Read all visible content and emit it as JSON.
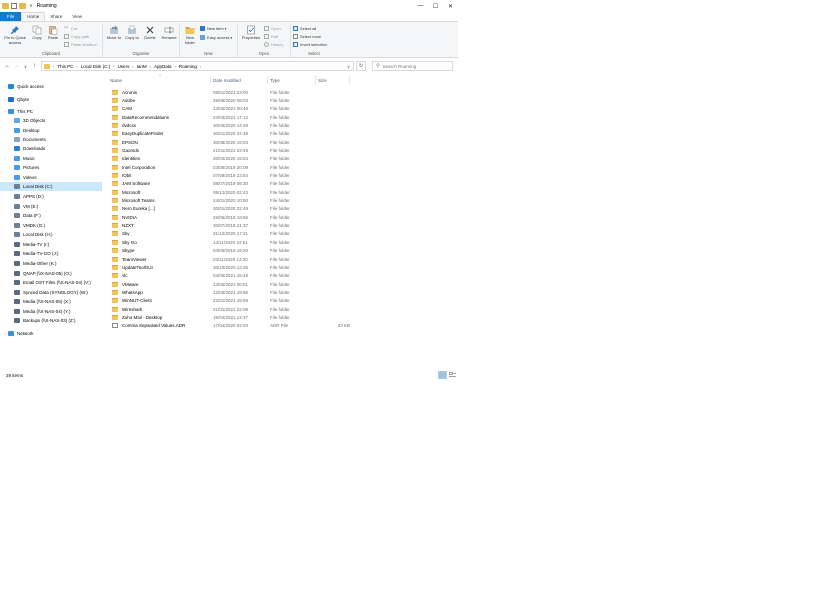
{
  "window": {
    "title": "Roaming",
    "minimize": "—",
    "maximize": "☐",
    "close": "✕"
  },
  "tabs": [
    {
      "label": "File"
    },
    {
      "label": "Home"
    },
    {
      "label": "Share"
    },
    {
      "label": "View"
    }
  ],
  "ribbon": {
    "clipboard": {
      "label": "Clipboard",
      "pin": "Pin to Quick access",
      "copy": "Copy",
      "paste": "Paste",
      "cut": "Cut",
      "copy_path": "Copy path",
      "paste_shortcut": "Paste shortcut"
    },
    "organise": {
      "label": "Organise",
      "move_to": "Move to",
      "copy_to": "Copy to",
      "delete": "Delete",
      "rename": "Rename"
    },
    "new": {
      "label": "New",
      "new_folder": "New folder",
      "new_item": "New item",
      "easy_access": "Easy access"
    },
    "open": {
      "label": "Open",
      "properties": "Properties",
      "open": "Open",
      "edit": "Edit",
      "history": "History"
    },
    "select": {
      "label": "Select",
      "select_all": "Select all",
      "select_none": "Select none",
      "invert": "Invert selection"
    }
  },
  "address": {
    "crumbs": [
      "This PC",
      "Local Disk (C:)",
      "Users",
      "IanM",
      "AppData",
      "Roaming"
    ],
    "search_placeholder": "Search Roaming"
  },
  "nav": [
    {
      "label": "Quick access",
      "icon": "star-icon",
      "color": "#1e88e5",
      "level": 0
    },
    {
      "label": "Qbyte",
      "icon": "cloud-icon",
      "color": "#1e6fbf",
      "level": 0
    },
    {
      "label": "This PC",
      "icon": "computer-icon",
      "color": "#3a8ee6",
      "level": 0
    },
    {
      "label": "3D Objects",
      "icon": "cube-icon",
      "color": "#5fa8e8",
      "level": 1
    },
    {
      "label": "Desktop",
      "icon": "desktop-icon",
      "color": "#4a9be6",
      "level": 1
    },
    {
      "label": "Documents",
      "icon": "documents-icon",
      "color": "#8aa4c0",
      "level": 1
    },
    {
      "label": "Downloads",
      "icon": "download-icon",
      "color": "#2a7fd6",
      "level": 1
    },
    {
      "label": "Music",
      "icon": "music-icon",
      "color": "#4a9be6",
      "level": 1
    },
    {
      "label": "Pictures",
      "icon": "pictures-icon",
      "color": "#4a9be6",
      "level": 1
    },
    {
      "label": "Videos",
      "icon": "videos-icon",
      "color": "#4a9be6",
      "level": 1
    },
    {
      "label": "Local Disk (C:)",
      "icon": "drive-icon",
      "color": "#6d7f93",
      "level": 1,
      "selected": true
    },
    {
      "label": "APPS (D:)",
      "icon": "drive-icon",
      "color": "#6d7f93",
      "level": 1
    },
    {
      "label": "VM (E:)",
      "icon": "drive-icon",
      "color": "#6d7f93",
      "level": 1
    },
    {
      "label": "Data (F:)",
      "icon": "drive-icon",
      "color": "#6d7f93",
      "level": 1
    },
    {
      "label": "VMDK (G:)",
      "icon": "drive-icon",
      "color": "#6d7f93",
      "level": 1
    },
    {
      "label": "Local Disk (H:)",
      "icon": "drive-icon",
      "color": "#6d7f93",
      "level": 1
    },
    {
      "label": "Media-TV (I:)",
      "icon": "network-drive-icon",
      "color": "#5b6b7c",
      "level": 1
    },
    {
      "label": "Media-TV-GO (J:)",
      "icon": "network-drive-icon",
      "color": "#5b6b7c",
      "level": 1
    },
    {
      "label": "Media-Other (K:)",
      "icon": "network-drive-icon",
      "color": "#5b6b7c",
      "level": 1
    },
    {
      "label": "QNAP (\\\\X-NAS-05) (O:)",
      "icon": "network-drive-icon",
      "color": "#5b6b7c",
      "level": 1
    },
    {
      "label": "Email OST Files (\\\\X-NAS-04) (V:)",
      "icon": "network-drive-icon",
      "color": "#5b6b7c",
      "level": 1
    },
    {
      "label": "Synced Data (SYNOLOGY) (W:)",
      "icon": "network-drive-icon",
      "color": "#5b6b7c",
      "level": 1
    },
    {
      "label": "Media (\\\\X-NAS-05) (X:)",
      "icon": "network-drive-icon",
      "color": "#5b6b7c",
      "level": 1
    },
    {
      "label": "Media (\\\\X-NAS-04) (Y:)",
      "icon": "network-drive-icon",
      "color": "#5b6b7c",
      "level": 1
    },
    {
      "label": "Backups (\\\\X-NAS-03) (Z:)",
      "icon": "network-drive-icon",
      "color": "#5b6b7c",
      "level": 1
    },
    {
      "label": "Network",
      "icon": "network-icon",
      "color": "#3a8ee6",
      "level": 0
    }
  ],
  "columns": {
    "name": "Name",
    "date": "Date modified",
    "type": "Type",
    "size": "Size"
  },
  "files": [
    {
      "name": "Acronis",
      "date": "09/01/2021 23:00",
      "type": "File folder",
      "size": ""
    },
    {
      "name": "Adobe",
      "date": "26/06/2020 08:03",
      "type": "File folder",
      "size": ""
    },
    {
      "name": "CAM",
      "date": "13/05/2021 00:48",
      "type": "File folder",
      "size": ""
    },
    {
      "name": "DataRecommendations",
      "date": "24/03/2021 17:12",
      "type": "File folder",
      "size": ""
    },
    {
      "name": "dvdcss",
      "date": "30/05/2020 14:29",
      "type": "File folder",
      "size": ""
    },
    {
      "name": "EasyDuplicateFinder",
      "date": "30/01/2020 22:49",
      "type": "File folder",
      "size": ""
    },
    {
      "name": "EPSON",
      "date": "30/08/2020 15:03",
      "type": "File folder",
      "size": ""
    },
    {
      "name": "Gaomds",
      "date": "21/01/2021 23:49",
      "type": "File folder",
      "size": ""
    },
    {
      "name": "Identities",
      "date": "20/04/2020 15:04",
      "type": "File folder",
      "size": ""
    },
    {
      "name": "Intel Corporation",
      "date": "03/05/2019 20:09",
      "type": "File folder",
      "size": ""
    },
    {
      "name": "IObit",
      "date": "07/08/2019 22:54",
      "type": "File folder",
      "size": ""
    },
    {
      "name": "JAM Software",
      "date": "08/07/2019 08:30",
      "type": "File folder",
      "size": ""
    },
    {
      "name": "Microsoft",
      "date": "09/12/2020 02:43",
      "type": "File folder",
      "size": ""
    },
    {
      "name": "Microsoft Teams",
      "date": "24/01/2020 10:50",
      "type": "File folder",
      "size": ""
    },
    {
      "name": "Nero Eureka [...]",
      "date": "30/01/2020 22:49",
      "type": "File folder",
      "size": ""
    },
    {
      "name": "NVIDIA",
      "date": "25/05/2019 19:55",
      "type": "File folder",
      "size": ""
    },
    {
      "name": "NZXT",
      "date": "30/07/2019 21:37",
      "type": "File folder",
      "size": ""
    },
    {
      "name": "Sky",
      "date": "31/10/2020 17:21",
      "type": "File folder",
      "size": ""
    },
    {
      "name": "Sky Go",
      "date": "14/11/2020 22:51",
      "type": "File folder",
      "size": ""
    },
    {
      "name": "Skype",
      "date": "04/05/2019 19:20",
      "type": "File folder",
      "size": ""
    },
    {
      "name": "TeamViewer",
      "date": "03/11/2020 13:20",
      "type": "File folder",
      "size": ""
    },
    {
      "name": "UpdateToolGUI",
      "date": "30/10/2020 12:25",
      "type": "File folder",
      "size": ""
    },
    {
      "name": "vlc",
      "date": "04/05/2021 15:48",
      "type": "File folder",
      "size": ""
    },
    {
      "name": "VMware",
      "date": "13/05/2021 00:51",
      "type": "File folder",
      "size": ""
    },
    {
      "name": "WhatsApp",
      "date": "12/05/2021 19:56",
      "type": "File folder",
      "size": ""
    },
    {
      "name": "WinNUT-Client",
      "date": "22/01/2021 15:59",
      "type": "File folder",
      "size": ""
    },
    {
      "name": "Wireshark",
      "date": "21/01/2021 22:08",
      "type": "File folder",
      "size": ""
    },
    {
      "name": "Zoho Mail - Desktop",
      "date": "15/04/2021 12:37",
      "type": "File folder",
      "size": ""
    },
    {
      "name": "Comma Separated Values.ADR",
      "date": "17/04/2020 02:03",
      "type": "ADR File",
      "size": "23 KB",
      "is_file": true
    }
  ],
  "status": {
    "count": "29 items"
  }
}
